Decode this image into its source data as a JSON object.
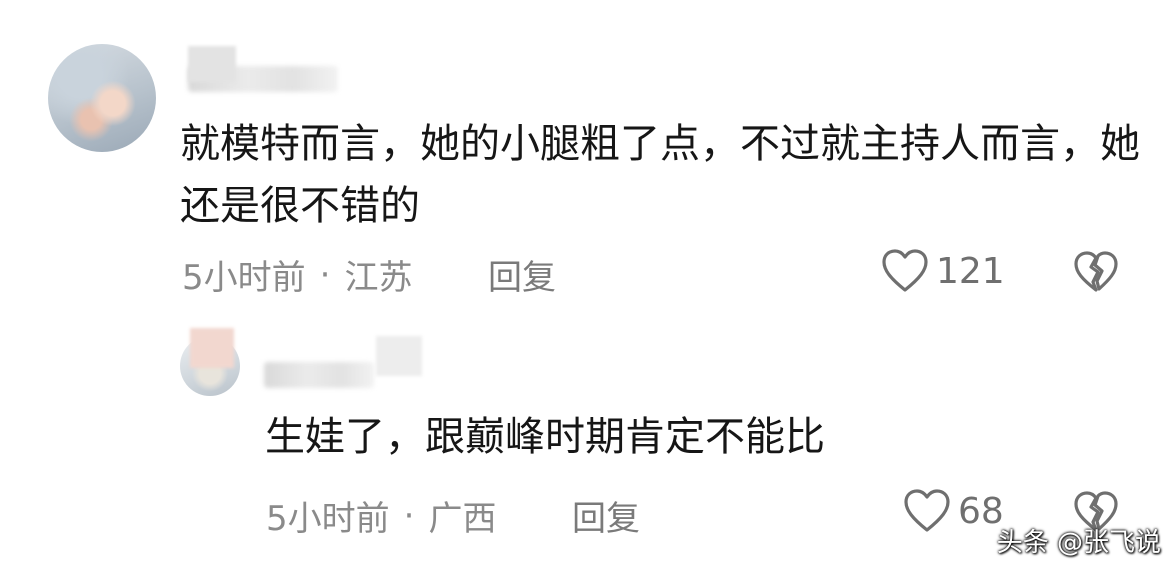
{
  "comments": [
    {
      "text": "就模特而言，她的小腿粗了点，不过就主持人而言，她还是很不错的",
      "time": "5小时前",
      "separator": "·",
      "location": "江苏",
      "reply_label": "回复",
      "likes": "121"
    },
    {
      "text": "生娃了，跟巅峰时期肯定不能比",
      "time": "5小时前",
      "separator": "·",
      "location": "广西",
      "reply_label": "回复",
      "likes": "68"
    }
  ],
  "watermark": "头条 @张飞说",
  "icons": {
    "like": "heart-outline-icon",
    "dislike": "broken-heart-icon"
  },
  "colors": {
    "text": "#161616",
    "meta": "#8a8a8a",
    "icon": "#6f6f6f"
  }
}
